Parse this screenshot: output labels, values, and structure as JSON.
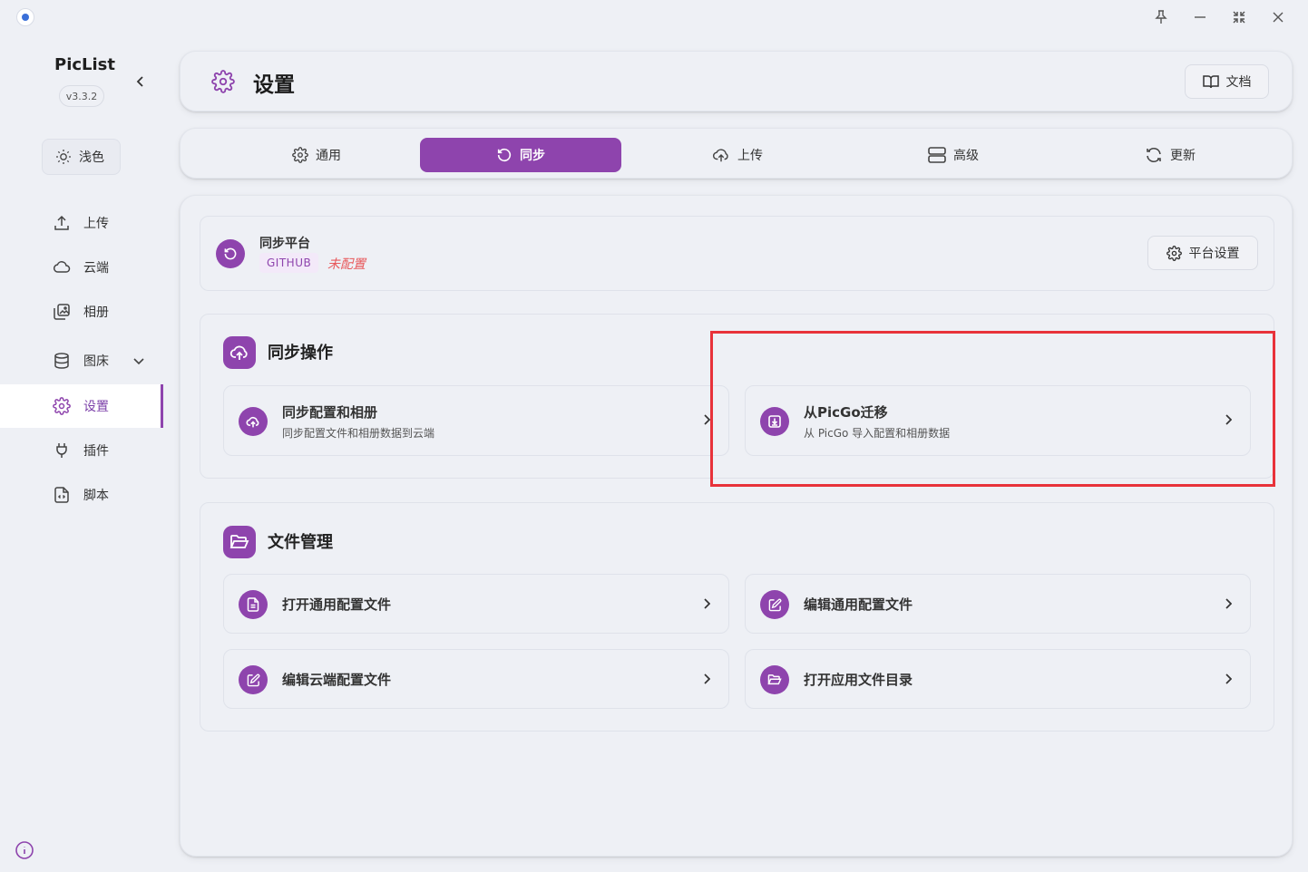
{
  "window": {
    "controls": [
      {
        "name": "pin-icon"
      },
      {
        "name": "minimize-icon"
      },
      {
        "name": "collapse-icon"
      },
      {
        "name": "close-icon"
      }
    ]
  },
  "sidebar": {
    "brand": "PicList",
    "version": "v3.3.2",
    "theme_label": "浅色",
    "items": [
      {
        "label": "上传",
        "icon": "upload-icon"
      },
      {
        "label": "云端",
        "icon": "cloud-icon"
      },
      {
        "label": "相册",
        "icon": "gallery-icon"
      },
      {
        "label": "图床",
        "icon": "database-icon"
      },
      {
        "label": "设置",
        "icon": "gear-icon",
        "active": true
      },
      {
        "label": "插件",
        "icon": "plug-icon"
      },
      {
        "label": "脚本",
        "icon": "script-icon"
      }
    ]
  },
  "header": {
    "title": "设置",
    "doc_label": "文档"
  },
  "tabs": [
    {
      "label": "通用",
      "icon": "gear-icon"
    },
    {
      "label": "同步",
      "icon": "sync-icon",
      "active": true
    },
    {
      "label": "上传",
      "icon": "cloud-upload-icon"
    },
    {
      "label": "高级",
      "icon": "server-icon"
    },
    {
      "label": "更新",
      "icon": "refresh-icon"
    }
  ],
  "platform": {
    "title": "同步平台",
    "tag": "GITHUB",
    "status": "未配置",
    "settings_label": "平台设置"
  },
  "sync_section": {
    "title": "同步操作",
    "actions": [
      {
        "title": "同步配置和相册",
        "subtitle": "同步配置文件和相册数据到云端"
      },
      {
        "title": "从PicGo迁移",
        "subtitle": "从 PicGo 导入配置和相册数据"
      }
    ]
  },
  "file_section": {
    "title": "文件管理",
    "actions": [
      {
        "title": "打开通用配置文件"
      },
      {
        "title": "编辑通用配置文件"
      },
      {
        "title": "编辑云端配置文件"
      },
      {
        "title": "打开应用文件目录"
      }
    ]
  },
  "colors": {
    "accent": "#8e44ad",
    "background": "#eef0f5",
    "warning": "#e8595c",
    "highlight_box": "#e8323a"
  }
}
